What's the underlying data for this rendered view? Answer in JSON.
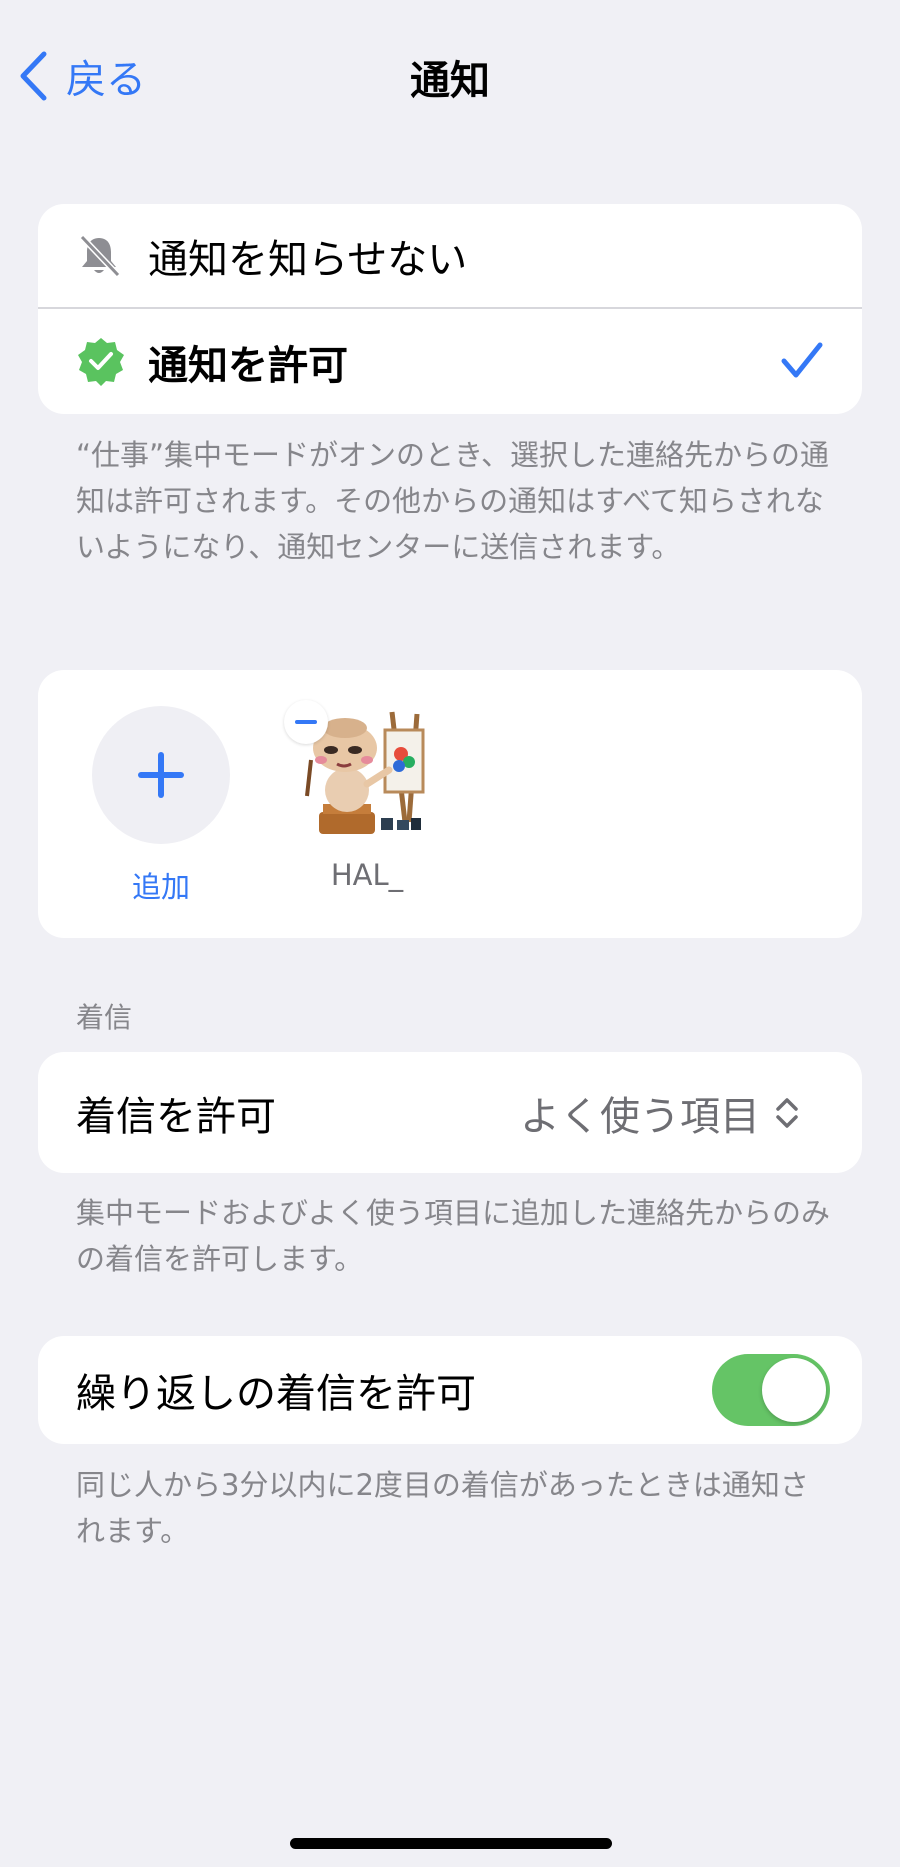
{
  "nav": {
    "back_label": "戻る",
    "title": "通知"
  },
  "notify_options": {
    "silence_label": "通知を知らせない",
    "allow_label": "通知を許可",
    "selected": "allow"
  },
  "notify_footnote": "“仕事”集中モードがオンのとき、選択した連絡先からの通知は許可されます。その他からの通知はすべて知らされないようになり、通知センターに送信されます。",
  "people": {
    "add_label": "追加",
    "contacts": [
      {
        "name": "HAL_"
      }
    ]
  },
  "calls": {
    "section_header": "着信",
    "allow_calls_label": "着信を許可",
    "allow_calls_value": "よく使う項目",
    "allow_calls_footnote": "集中モードおよびよく使う項目に追加した連絡先からのみの着信を許可します。",
    "repeated_label": "繰り返しの着信を許可",
    "repeated_enabled": true,
    "repeated_footnote": "同じ人から3分以内に2度目の着信があったときは通知されます。"
  },
  "colors": {
    "accent": "#3478f6",
    "toggle_on": "#65c466",
    "allow_badge": "#5ac35f",
    "background": "#f0f0f5"
  }
}
